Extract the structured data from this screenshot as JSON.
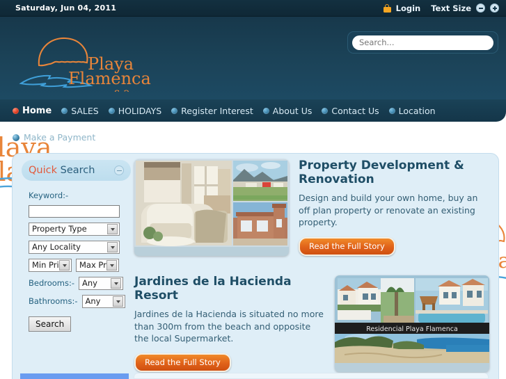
{
  "topbar": {
    "date": "Saturday, Jun 04, 2011",
    "lock_icon": "lock-icon",
    "login_label": "Login",
    "text_size_label": "Text Size",
    "decrease_icon": "minus-circle-icon",
    "increase_icon": "plus-circle-icon"
  },
  "header": {
    "logo_line1": "Playa",
    "logo_line2": "Flamenca",
    "logo_line3": "s.a.",
    "logo_icon": "shell-sun-icon",
    "wave_icon": "wave-lines-icon",
    "search_placeholder": "Search...",
    "search_value": "",
    "search_icon": "search-icon"
  },
  "nav": {
    "items": [
      {
        "label": "Home",
        "active": true
      },
      {
        "label": "SALES",
        "active": false
      },
      {
        "label": "HOLIDAYS",
        "active": false
      },
      {
        "label": "Register Interest",
        "active": false
      },
      {
        "label": "About Us",
        "active": false
      },
      {
        "label": "Contact Us",
        "active": false
      },
      {
        "label": "Location",
        "active": false
      }
    ]
  },
  "page": {
    "payment_label": "Make a Payment",
    "payment_bullet_icon": "bullet-icon",
    "watermark_line1": "Playa",
    "watermark_line2": "Flamenca"
  },
  "quick_search": {
    "title_first": "Quick",
    "title_second": " Search",
    "collapse_icon": "collapse-minus-icon",
    "keyword_label": "Keyword:-",
    "keyword_value": "",
    "property_type": "Property Type",
    "locality": "Any Locality",
    "min_price": "Min Pric",
    "max_price": "Max Pri",
    "bedrooms_label": "Bedrooms:-",
    "bedrooms_value": "Any",
    "bathrooms_label": "Bathrooms:-",
    "bathrooms_value": "Any",
    "search_button": "Search"
  },
  "articles": [
    {
      "title": "Property Development & Renovation",
      "body": "Design and build your own home, buy an off plan property or renovate an existing property.",
      "button": "Read the Full Story",
      "image_name": "property-collage-image"
    },
    {
      "title": "Jardines de la Hacienda Resort",
      "body": "Jardines de la Hacienda is situated no more than 300m from the beach and opposite the local Supermarket.",
      "button": "Read the Full Story",
      "image_name": "resort-collage-image",
      "image_caption": "Residencial  Playa  Flamenca"
    }
  ],
  "colors": {
    "header_dark": "#17384b",
    "topbar": "#0f2836",
    "panel_bg": "#dfeef7",
    "accent_orange": "#e2593a",
    "button_orange": "#e1631a",
    "link_blue": "#23607f",
    "bottom_tab_blue": "#6a9cf0"
  }
}
